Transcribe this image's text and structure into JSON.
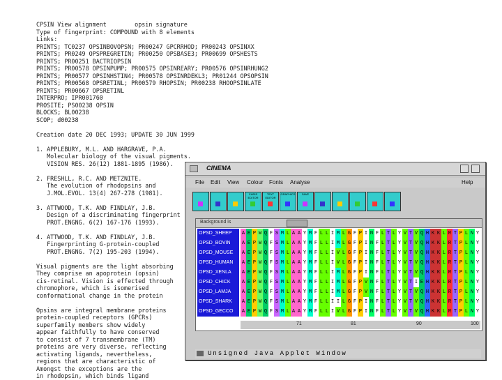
{
  "document": {
    "lines": [
      "CPSIN View alignment        opsin signature",
      "Type of fingerprint: COMPOUND with 8 elements",
      "Links:",
      "PRINTS; TC0237 OPSINBOVOPSN; PR00247 GPCRRHOD; PR00243 OPSINXX",
      "PRINTS; PR0249 OPSPREGRETIN; PR00250 OPSBASE3; PR00699 OPSHESTS",
      "PRINTS; PR00251 BACTRIOPSIN",
      "PRINTS; PR00578 OPSINPUMP; PR00575 OPSINREARY; PR00576 OPSINRHUNG2",
      "PRINTS; PR00577 OPSINHSTIN4; PR00578 OPSINRDEKL3; PR01244 OPSOPSIN",
      "PRINTS; PR00568 OPSRETINL; PR00579 RHOPSIN; PR00238 RHOOPSINLATE",
      "PRINTS; PR00667 OPSRETINL",
      "INTERPRO; IPR001760",
      "PROSITE; PS00238 OPSIN",
      "BLOCKS; BL00238",
      "SCOP; d00238",
      "",
      "Creation date 20 DEC 1993; UPDATE 30 JUN 1999",
      "",
      "1. APPLEBURY, M.L. AND HARGRAVE, P.A.",
      "   Molecular biology of the visual pigments.",
      "   VISION RES. 26(12) 1881-1895 (1986).",
      "",
      "2. FRESHLL, R.C. AND METZNITE. ",
      "   The evolution of rhodopsins and",
      "   J.MOL.EVOL. 13(4) 267-278 (1981).",
      "",
      "3. ATTWOOD, T.K. AND FINDLAY, J.B.",
      "   Design of a discriminating fingerprint",
      "   PROT.ENGNG. 6(2) 167-176 (1993).",
      "",
      "4. ATTWOOD, T.K. AND FINDLAY, J.B.",
      "   Fingerprinting G-protein-coupled",
      "   PROT.ENGNG. 7(2) 195-203 (1994).",
      "",
      "Visual pigments are the light absorbing",
      "They comprise an apoprotein (opsin)",
      "cis-retinal. Vision is effected through",
      "chromophore, which is isomerised",
      "conformational change in the protein",
      "",
      "Opsins are integral membrane proteins",
      "protein-coupled receptors (GPCRs)",
      "superfamily members show widely",
      "appear faithfully to have conserved",
      "to consist of 7 transmembrane (TM)",
      "proteins are very diverse, reflecting",
      "activating ligands, nevertheless,",
      "regions that are characteristic of",
      "Amongst the exceptions are the",
      "in rhodopsin, which binds ligand"
    ]
  },
  "applet": {
    "title": "CINEMA",
    "menus": [
      "File",
      "Edit",
      "View",
      "Colour",
      "Fonts",
      "Analyse"
    ],
    "help": "Help",
    "toolbar": [
      {
        "name": "tool-1",
        "caption": ""
      },
      {
        "name": "tool-2",
        "caption": ""
      },
      {
        "name": "tool-3",
        "caption": ""
      },
      {
        "name": "tool-4",
        "caption": "CHRIS EDITOR"
      },
      {
        "name": "tool-5",
        "caption": "TEXT EDITOR"
      },
      {
        "name": "tool-6",
        "caption": "GRAPHICS"
      },
      {
        "name": "tool-7",
        "caption": "SAVE"
      },
      {
        "name": "tool-8",
        "caption": ""
      },
      {
        "name": "tool-9",
        "caption": ""
      },
      {
        "name": "tool-10",
        "caption": ""
      },
      {
        "name": "tool-11",
        "caption": ""
      },
      {
        "name": "tool-12",
        "caption": ""
      }
    ],
    "seq_header_label": "Background is",
    "sequence_names": [
      "OPSD_SHEEP",
      "OPSD_BOVIN",
      "OPSD_MOUSE",
      "OPSD_HUMAN",
      "OPSD_XENLA",
      "OPSD_CHICK",
      "OPSD_LAMJA",
      "OPSD_SHARK",
      "OPSD_GECCO"
    ],
    "alignment_rows": [
      "AEPWQFSMLAAYMFLLIMLGFPINFLTLYVTVQHKKLRTPLNYILLN",
      "AEPWQFSMLAAYMFLLIMLGFPINFLTLYVTVQHKKLRTPLNYILLN",
      "AEPWQFSMLAAYMFLLIVLGFPINFLTLYVTVQHKKLRTPLNYILLN",
      "AEPWQFSMLAAYMFLLIVLGFPINFLTLYVTVQHKKLRTPLNYILLN",
      "AEPWQFSMLAAYMFLLIMLGFPINFLTLYVTVQHKKLRTPLNYILLN",
      "AEPWQFSMLAAYMFLLIMLGFPVNFLTLYVTIEHKKLRTPLNYILLN",
      "AEPWQFSMLAAYMFLLIMLGFPVNFLTLYVTVQHKKLRTPLNYILLN",
      "AEPWQFSMLAAYMFLLIILGFPINFLTLYVTVQHKKLRTPLNYILLN",
      "AEPWQFSMLAAYMFLLIVLGFPINFLTLYVTVQHKKLRTPLNYILLN"
    ],
    "ruler_ticks": [
      "71",
      "81",
      "90",
      "100"
    ],
    "status": "Unsigned Java Applet Window",
    "residue_colors": {
      "A": "#ff66cc",
      "E": "#00cc66",
      "P": "#ffcc00",
      "W": "#66ff66",
      "Q": "#00cc66",
      "F": "#ffffff",
      "S": "#cc66ff",
      "M": "#00ffcc",
      "L": "#66ff00",
      "Y": "#ffffff",
      "I": "#ffffff",
      "V": "#66ff00",
      "G": "#ff9900",
      "N": "#00ff66",
      "T": "#9966ff",
      "H": "#3366ff",
      "K": "#cc3333",
      "R": "#ff3333"
    }
  }
}
